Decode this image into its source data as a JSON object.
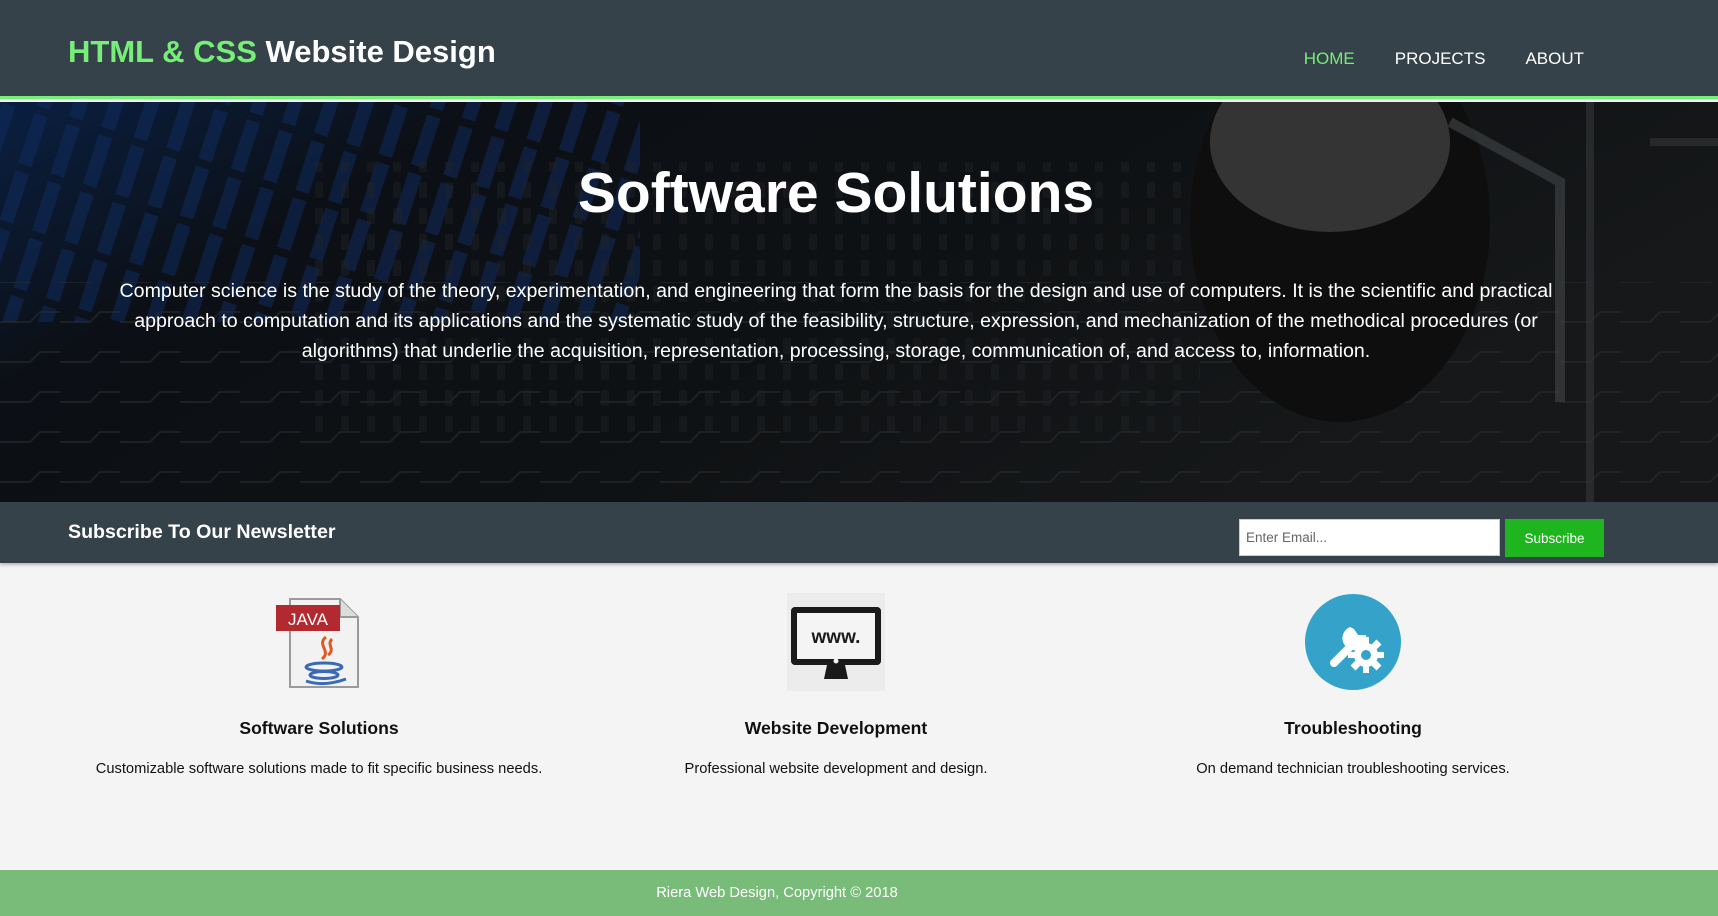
{
  "header": {
    "logo_highlight": "HTML & CSS",
    "logo_rest": "Website Design",
    "nav": [
      {
        "label": "HOME",
        "active": true
      },
      {
        "label": "PROJECTS",
        "active": false
      },
      {
        "label": "ABOUT",
        "active": false
      }
    ]
  },
  "hero": {
    "title": "Software Solutions",
    "text": "Computer science is the study of the theory, experimentation, and engineering that form the basis for the design and use of computers. It is the scientific and practical approach to computation and its applications and the systematic study of the feasibility, structure, expression, and mechanization of the methodical procedures (or algorithms) that underlie the acquisition, representation, processing, storage, communication of, and access to, information."
  },
  "newsletter": {
    "heading": "Subscribe To Our Newsletter",
    "email_placeholder": "Enter Email...",
    "email_value": "",
    "button_label": "Subscribe"
  },
  "boxes": [
    {
      "icon": "java-file-icon",
      "icon_text": "JAVA",
      "title": "Software Solutions",
      "text": "Customizable software solutions made to fit specific business needs."
    },
    {
      "icon": "monitor-www-icon",
      "icon_text": "www.",
      "title": "Website Development",
      "text": "Professional website development and design."
    },
    {
      "icon": "wrench-gear-icon",
      "icon_text": "",
      "title": "Troubleshooting",
      "text": "On demand technician troubleshooting services."
    }
  ],
  "footer": {
    "text": "Riera Web Design, Copyright © 2018"
  },
  "colors": {
    "header_bg": "#35424a",
    "accent_green": "#77ee77",
    "subscribe_button": "#1fb51f",
    "footer_bg": "#79bb79",
    "tool_icon_blue": "#35a3c9"
  }
}
